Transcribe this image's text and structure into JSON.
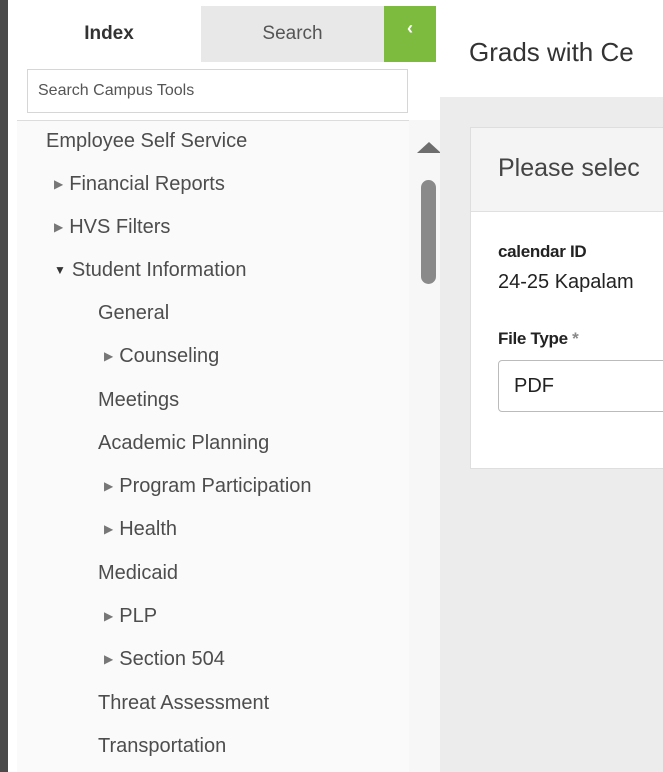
{
  "sidebar": {
    "tabs": {
      "index": "Index",
      "search": "Search"
    },
    "collapse_icon": "chevron-left-icon",
    "collapse_glyph": "‹",
    "search_placeholder": "Search Campus Tools",
    "tree": [
      {
        "label": "Employee Self Service",
        "marker": "none"
      },
      {
        "label": "Financial Reports",
        "marker": "collapsed"
      },
      {
        "label": "HVS Filters",
        "marker": "collapsed"
      },
      {
        "label": "Student Information",
        "marker": "expanded"
      },
      {
        "label": "General",
        "marker": "none"
      },
      {
        "label": "Counseling",
        "marker": "collapsed"
      },
      {
        "label": "Meetings",
        "marker": "none"
      },
      {
        "label": "Academic Planning",
        "marker": "none"
      },
      {
        "label": "Program Participation",
        "marker": "collapsed"
      },
      {
        "label": "Health",
        "marker": "collapsed"
      },
      {
        "label": "Medicaid",
        "marker": "none"
      },
      {
        "label": "PLP",
        "marker": "collapsed"
      },
      {
        "label": "Section 504",
        "marker": "collapsed"
      },
      {
        "label": "Threat Assessment",
        "marker": "none"
      },
      {
        "label": "Transportation",
        "marker": "none"
      }
    ]
  },
  "main": {
    "title": "Grads with Ce",
    "card_title": "Please selec",
    "calendar_label": "calendar ID",
    "calendar_value": "24-25 Kapalam",
    "file_type_label": "File Type",
    "required_marker": "*",
    "file_type_value": "PDF"
  },
  "colors": {
    "accent": "#7dbb3f",
    "border_dark": "#4a4a4a",
    "panel_bg": "#ececec"
  }
}
